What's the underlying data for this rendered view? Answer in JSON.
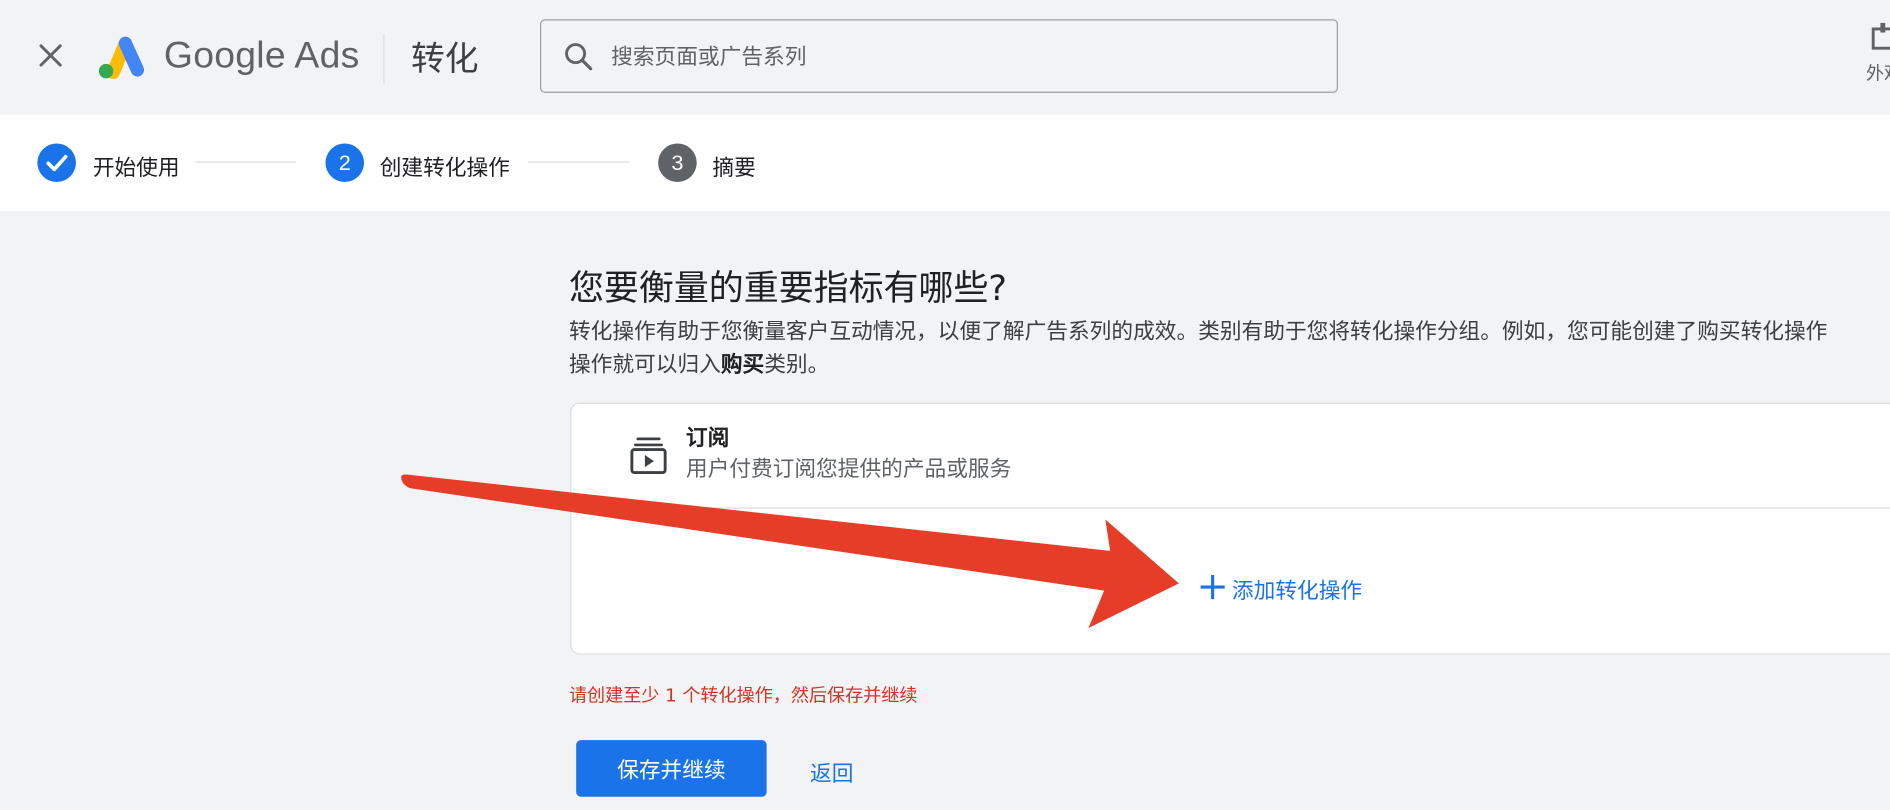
{
  "header": {
    "brand": "Google Ads",
    "page_title": "转化",
    "search_placeholder": "搜索页面或广告系列",
    "appearance_label": "外观"
  },
  "stepper": {
    "steps": [
      {
        "label": "开始使用",
        "number": "",
        "state": "done"
      },
      {
        "label": "创建转化操作",
        "number": "2",
        "state": "active"
      },
      {
        "label": "摘要",
        "number": "3",
        "state": "pending"
      }
    ]
  },
  "main": {
    "question": "您要衡量的重要指标有哪些?",
    "desc_line1": "转化操作有助于您衡量客户互动情况，以便了解广告系列的成效。类别有助于您将转化操作分组。例如，您可能创建了购买转化操作",
    "desc_line2_pre": "操作就可以归入",
    "desc_line2_bold": "购买",
    "desc_line2_post": "类别。",
    "category": {
      "title": "订阅",
      "subtitle": "用户付费订阅您提供的产品或服务",
      "icon": "subscriptions-icon"
    },
    "add_action_label": "添加转化操作",
    "error_message": "请创建至少 1 个转化操作，然后保存并继续",
    "save_button": "保存并继续",
    "back_button": "返回"
  },
  "colors": {
    "accent": "#1a73e8",
    "error": "#d93025",
    "annotation_arrow": "#e53d27",
    "pending_step": "#5f6368"
  }
}
